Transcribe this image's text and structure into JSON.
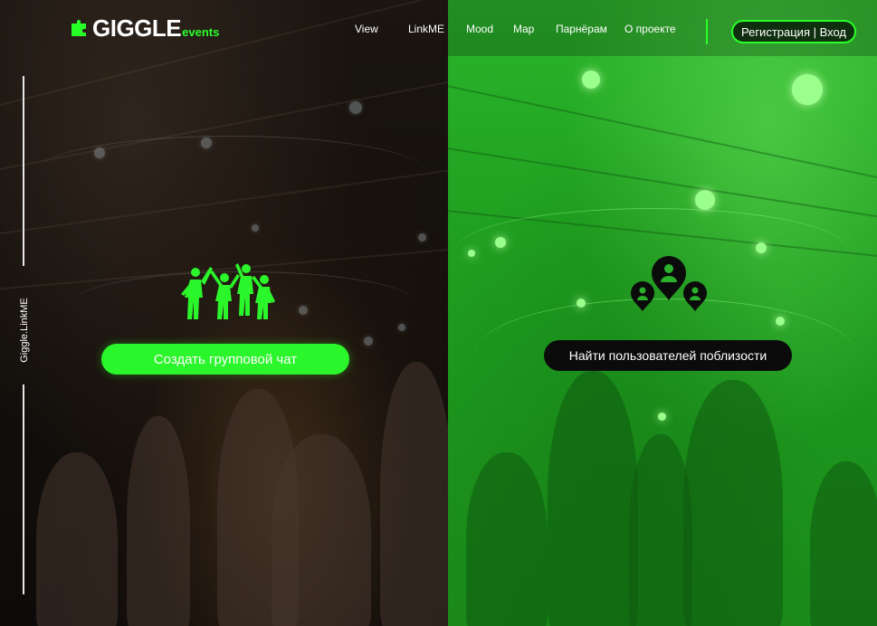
{
  "brand": {
    "name": "GIGGLE",
    "suffix": "events",
    "accent_color": "#27ff27"
  },
  "nav": {
    "items": [
      {
        "label": "View"
      },
      {
        "label": "LinkME"
      },
      {
        "label": "Mood"
      },
      {
        "label": "Map"
      },
      {
        "label": "Парнёрам"
      },
      {
        "label": "О проекте"
      }
    ],
    "auth_label": "Регистрация | Вход"
  },
  "side": {
    "label": "Giggle.LinkME"
  },
  "left_panel": {
    "icon": "party-people-icon",
    "button_label": "Создать групповой чат"
  },
  "right_panel": {
    "icon": "nearby-users-icon",
    "button_label": "Найти пользователей поблизости"
  }
}
